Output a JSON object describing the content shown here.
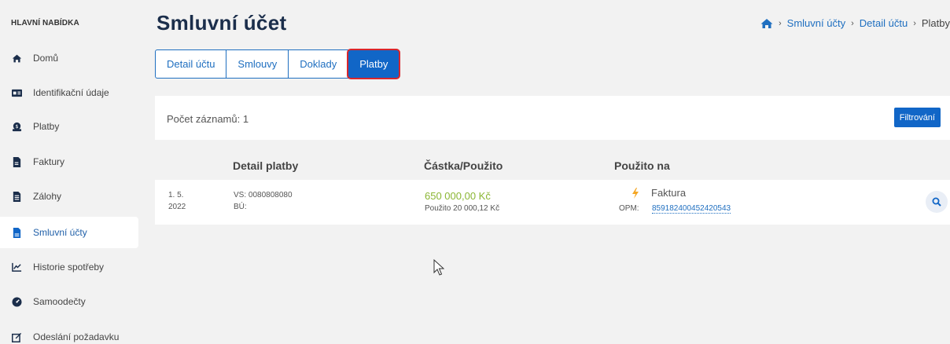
{
  "sidebar": {
    "header": "HLAVNÍ NABÍDKA",
    "items": [
      {
        "label": "Domů",
        "icon": "home-icon"
      },
      {
        "label": "Identifikační údaje",
        "icon": "id-card-icon"
      },
      {
        "label": "Platby",
        "icon": "money-bag-icon"
      },
      {
        "label": "Faktury",
        "icon": "invoice-icon"
      },
      {
        "label": "Zálohy",
        "icon": "document-icon"
      },
      {
        "label": "Smluvní účty",
        "icon": "file-icon",
        "active": true
      },
      {
        "label": "Historie spotřeby",
        "icon": "chart-icon"
      },
      {
        "label": "Samoodečty",
        "icon": "meter-icon"
      },
      {
        "label": "Odeslání požadavku",
        "icon": "edit-icon"
      }
    ]
  },
  "header": {
    "title": "Smluvní účet",
    "breadcrumb": [
      "Smluvní účty",
      "Detail účtu",
      "Platby"
    ]
  },
  "tabs": [
    {
      "label": "Detail účtu"
    },
    {
      "label": "Smlouvy"
    },
    {
      "label": "Doklady"
    },
    {
      "label": "Platby",
      "active": true
    }
  ],
  "list": {
    "count_label": "Počet záznamů: 1",
    "filter_label": "Filtrování",
    "columns": [
      "Detail platby",
      "Částka/Použito",
      "Použito na"
    ],
    "rows": [
      {
        "date_line1": "1. 5.",
        "date_line2": "2022",
        "vs": "VS: 0080808080",
        "bu": "BÚ:",
        "amount": "650 000,00 Kč",
        "used": "Použito 20 000,12 Kč",
        "used_on": "Faktura",
        "opm_label": "OPM:",
        "opm_value": "859182400452420543"
      }
    ]
  },
  "colors": {
    "primary": "#1166c7",
    "amount_green": "#8bb634",
    "highlight_red": "#d9262c",
    "bolt_orange": "#f5a623"
  }
}
